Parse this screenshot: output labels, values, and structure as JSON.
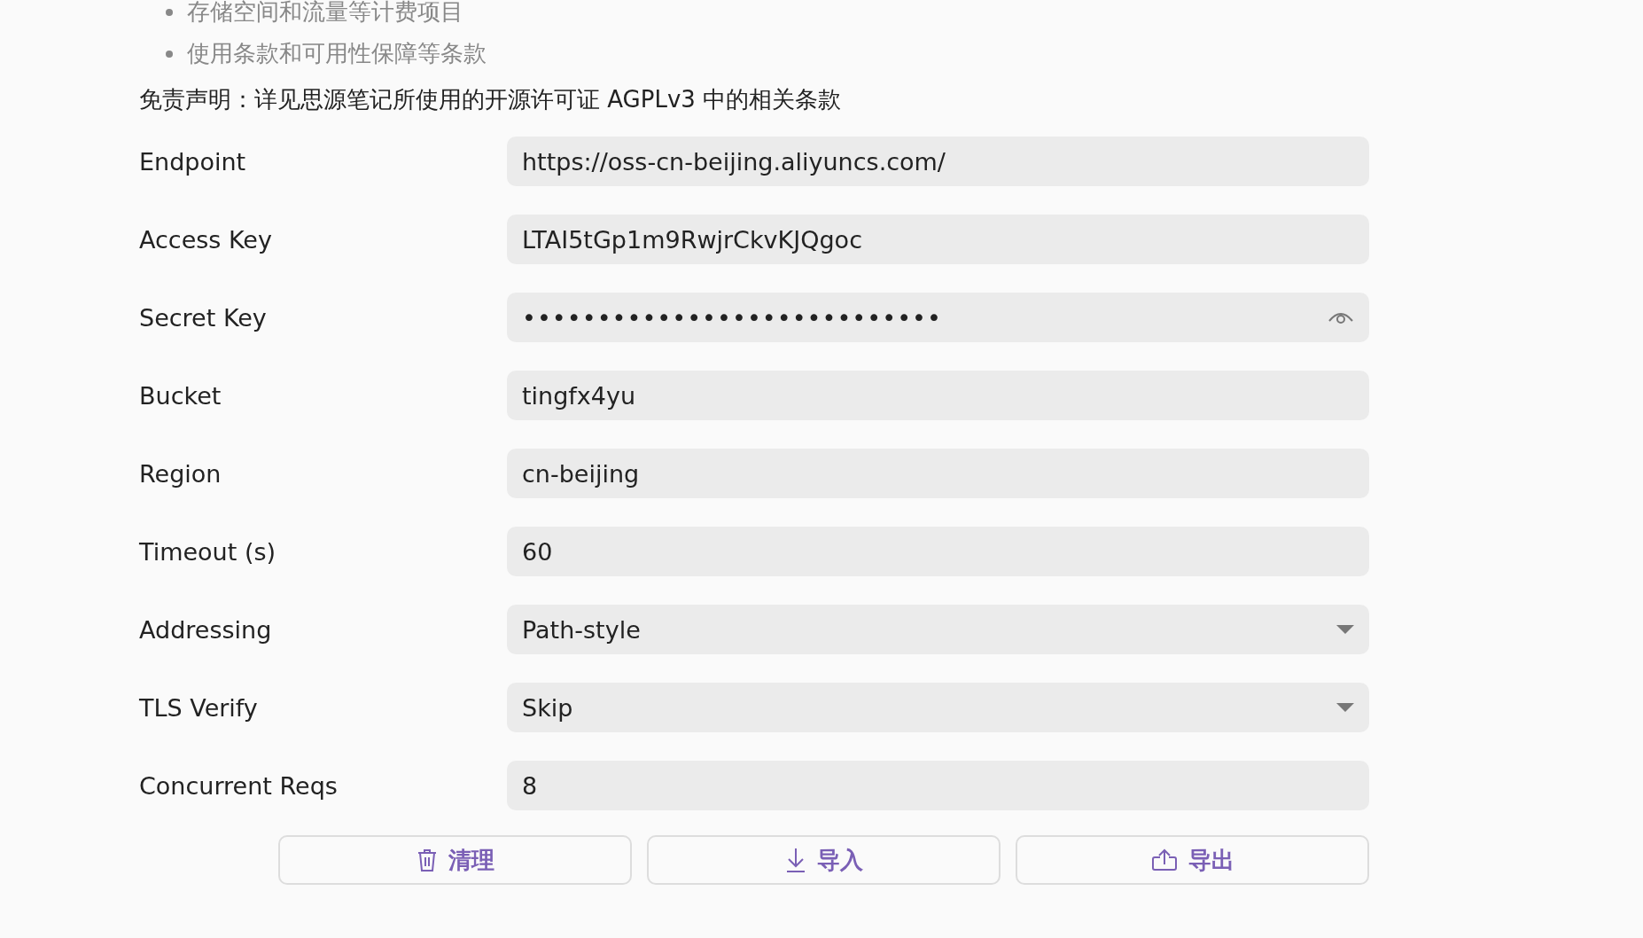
{
  "bullets": [
    "存储空间和流量等计费项目",
    "使用条款和可用性保障等条款"
  ],
  "disclaimer": "免责声明：详见思源笔记所使用的开源许可证 AGPLv3 中的相关条款",
  "fields": [
    {
      "label": "Endpoint",
      "kind": "text",
      "value": "https://oss-cn-beijing.aliyuncs.com/"
    },
    {
      "label": "Access Key",
      "kind": "text",
      "value": "LTAI5tGp1m9RwjrCkvKJQgoc"
    },
    {
      "label": "Secret Key",
      "kind": "password",
      "value": "••••••••••••••••••••••••••••"
    },
    {
      "label": "Bucket",
      "kind": "text",
      "value": "tingfx4yu"
    },
    {
      "label": "Region",
      "kind": "text",
      "value": "cn-beijing"
    },
    {
      "label": "Timeout (s)",
      "kind": "text",
      "value": "60"
    },
    {
      "label": "Addressing",
      "kind": "select",
      "value": "Path-style"
    },
    {
      "label": "TLS Verify",
      "kind": "select",
      "value": "Skip"
    },
    {
      "label": "Concurrent Reqs",
      "kind": "text",
      "value": "8"
    }
  ],
  "buttons": [
    {
      "label": "清理",
      "kind": "trash"
    },
    {
      "label": "导入",
      "kind": "import"
    },
    {
      "label": "导出",
      "kind": "export"
    }
  ]
}
